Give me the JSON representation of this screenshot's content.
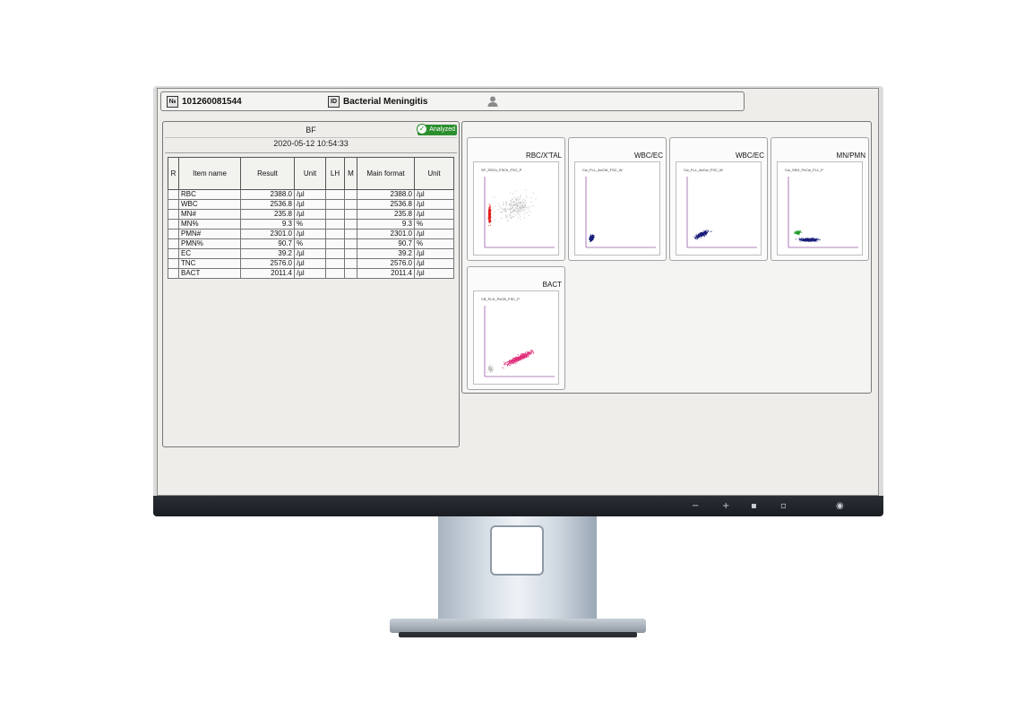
{
  "header": {
    "sample_no_badge": "№",
    "sample_no": "101260081544",
    "id_badge": "ID",
    "patient_id": "Bacterial Meningitis",
    "patient_icon": "person-icon"
  },
  "left_panel": {
    "mode": "BF",
    "status": "Analyzed",
    "datetime": "2020-05-12 10:54:33",
    "columns": [
      "R",
      "Item name",
      "Result",
      "Unit",
      "LH",
      "M",
      "Main format",
      "Unit"
    ],
    "rows": [
      {
        "item": "RBC",
        "result": "2388.0",
        "unit": "/µl",
        "main": "2388.0",
        "unit2": "/µl"
      },
      {
        "item": "WBC",
        "result": "2536.8",
        "unit": "/µl",
        "main": "2536.8",
        "unit2": "/µl"
      },
      {
        "item": "MN#",
        "result": "235.8",
        "unit": "/µl",
        "main": "235.8",
        "unit2": "/µl"
      },
      {
        "item": "MN%",
        "result": "9.3",
        "unit": "%",
        "main": "9.3",
        "unit2": "%"
      },
      {
        "item": "PMN#",
        "result": "2301.0",
        "unit": "/µl",
        "main": "2301.0",
        "unit2": "/µl"
      },
      {
        "item": "PMN%",
        "result": "90.7",
        "unit": "%",
        "main": "90.7",
        "unit2": "%"
      },
      {
        "item": "EC",
        "result": "39.2",
        "unit": "/µl",
        "main": "39.2",
        "unit2": "/µl"
      },
      {
        "item": "TNC",
        "result": "2576.0",
        "unit": "/µl",
        "main": "2576.0",
        "unit2": "/µl"
      },
      {
        "item": "BACT",
        "result": "2011.4",
        "unit": "/µl",
        "main": "2011.4",
        "unit2": "/µl"
      }
    ]
  },
  "scattergrams": [
    {
      "title": "RBC/X'TAL",
      "axis_label": "SF_SSCh_FSCh_FSC_P",
      "color": "#e02020"
    },
    {
      "title": "WBC/EC",
      "axis_label": "Cw_FLL_AxCW_FSC_W",
      "color": "#1a1f7a"
    },
    {
      "title": "WBC/EC",
      "axis_label": "Cw_FLL_AxCw_FSC_W",
      "color": "#1a1f7a"
    },
    {
      "title": "MN/PMN",
      "axis_label": "Cw_SSH_PxCw_FLL_P",
      "color": "#1a1f7a"
    },
    {
      "title": "BACT",
      "axis_label": "CB_FLH_PxCB_FSC_P",
      "color": "#e0307a"
    }
  ],
  "monitor_controls": [
    "−",
    "+",
    "▪",
    "▫",
    "◉"
  ]
}
